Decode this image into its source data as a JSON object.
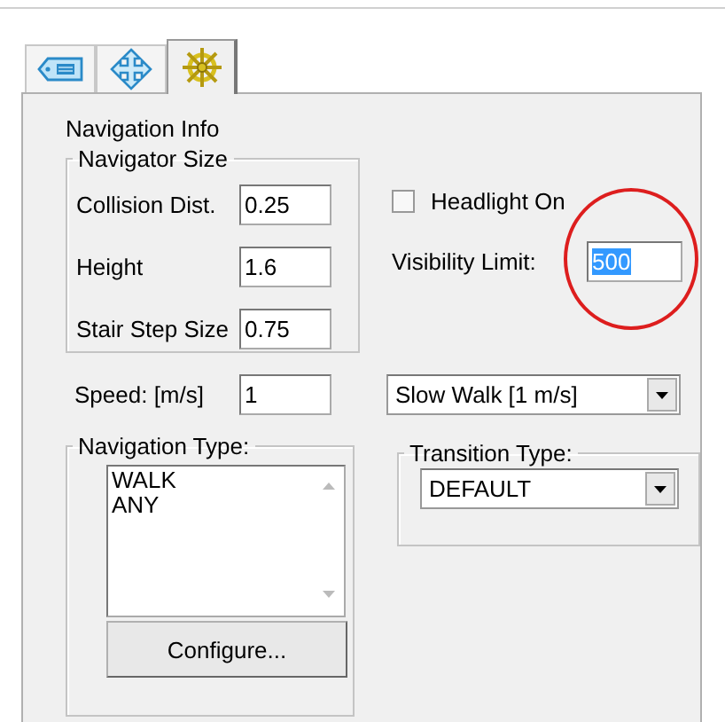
{
  "tabs": [
    {
      "kind": "tag",
      "selected": false
    },
    {
      "kind": "move",
      "selected": false
    },
    {
      "kind": "wheel",
      "selected": true
    }
  ],
  "section_title": "Navigation Info",
  "navigator_size": {
    "title": "Navigator Size",
    "fields": [
      {
        "label": "Collision Dist.",
        "value": "0.25"
      },
      {
        "label": "Height",
        "value": "1.6"
      },
      {
        "label": "Stair Step Size",
        "value": "0.75"
      }
    ]
  },
  "headlight": {
    "label": "Headlight On",
    "checked": false
  },
  "visibility": {
    "label": "Visibility Limit:",
    "value": "500",
    "text_selected": true,
    "highlight": {
      "kind": "circle"
    }
  },
  "speed": {
    "label": "Speed: [m/s]",
    "value": "1",
    "preset": "Slow Walk [1 m/s]"
  },
  "navigation_type": {
    "title": "Navigation Type:",
    "items": [
      {
        "label": "WALK",
        "selected": false
      },
      {
        "label": "ANY",
        "selected": false
      }
    ],
    "button": "Configure..."
  },
  "transition_type": {
    "title": "Transition Type:",
    "value": "DEFAULT"
  }
}
